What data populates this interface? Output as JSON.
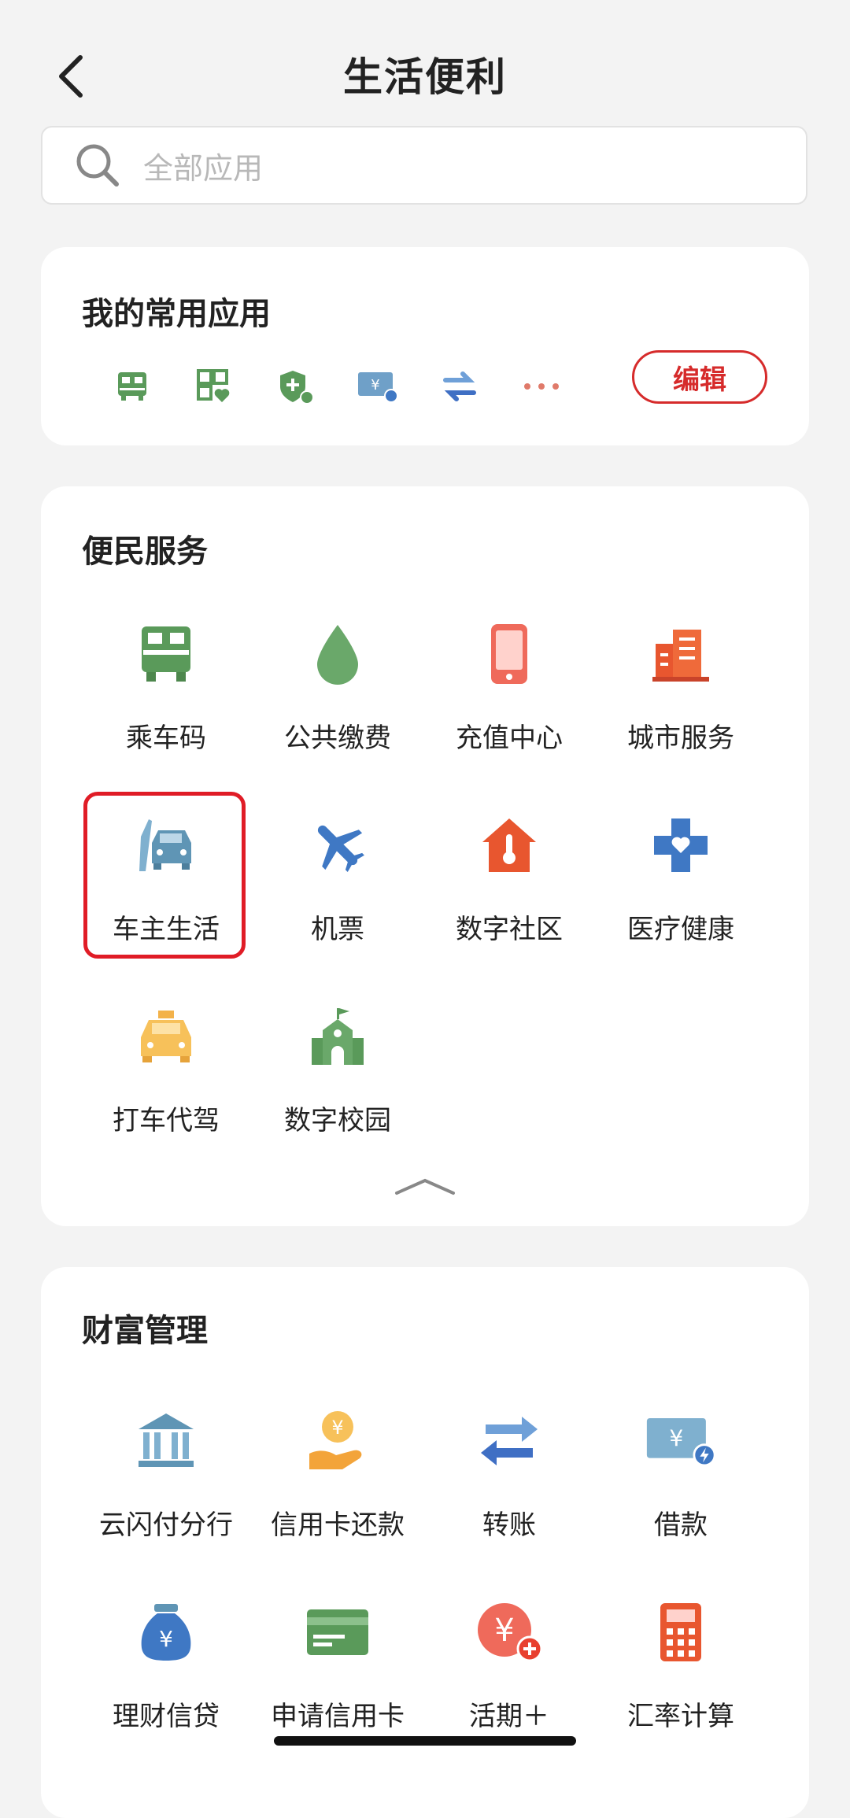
{
  "header": {
    "title": "生活便利"
  },
  "search": {
    "placeholder": "全部应用"
  },
  "favorites": {
    "title": "我的常用应用",
    "edit_label": "编辑",
    "icons": [
      "bus-code-icon",
      "qr-heart-icon",
      "shield-plus-icon",
      "loan-card-icon",
      "transfer-arrows-icon",
      "more-dots-icon"
    ]
  },
  "services": {
    "title": "便民服务",
    "items": [
      {
        "label": "乘车码",
        "icon": "bus-icon"
      },
      {
        "label": "公共缴费",
        "icon": "water-drop-icon"
      },
      {
        "label": "充值中心",
        "icon": "phone-icon"
      },
      {
        "label": "城市服务",
        "icon": "building-icon"
      },
      {
        "label": "车主生活",
        "icon": "car-icon"
      },
      {
        "label": "机票",
        "icon": "airplane-icon"
      },
      {
        "label": "数字社区",
        "icon": "house-thermometer-icon"
      },
      {
        "label": "医疗健康",
        "icon": "medical-cross-icon"
      },
      {
        "label": "打车代驾",
        "icon": "taxi-icon"
      },
      {
        "label": "数字校园",
        "icon": "school-icon"
      }
    ],
    "highlighted": "车主生活"
  },
  "wealth": {
    "title": "财富管理",
    "items": [
      {
        "label": "云闪付分行",
        "icon": "bank-icon"
      },
      {
        "label": "信用卡还款",
        "icon": "hand-coin-icon"
      },
      {
        "label": "转账",
        "icon": "transfer-icon"
      },
      {
        "label": "借款",
        "icon": "loan-icon"
      },
      {
        "label": "理财信贷",
        "icon": "money-bag-icon"
      },
      {
        "label": "申请信用卡",
        "icon": "credit-card-icon"
      },
      {
        "label": "活期＋",
        "icon": "coin-plus-icon"
      },
      {
        "label": "汇率计算",
        "icon": "calculator-icon"
      }
    ]
  },
  "colors": {
    "accent_red": "#d62b2b",
    "green": "#5a9a5a",
    "blue": "#3f78c4",
    "orange": "#e8562f"
  }
}
